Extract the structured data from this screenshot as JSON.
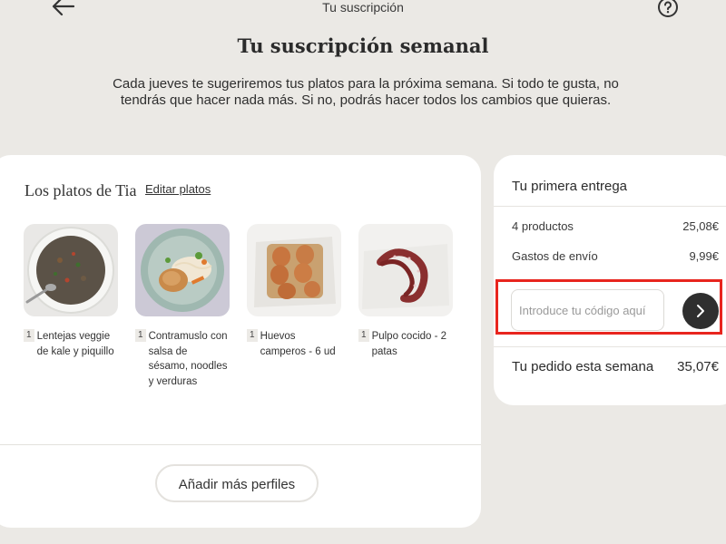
{
  "header": {
    "title": "Tu suscripción",
    "back_icon": "arrow-left-icon",
    "help_icon": "question-circle-icon"
  },
  "page": {
    "title": "Tu suscripción semanal",
    "intro": "Cada jueves te sugeriremos tus platos para la próxima semana. Si todo te gusta, no tendrás que hacer nada más. Si no, podrás hacer todos los cambios que quieras."
  },
  "plates": {
    "heading": "Los platos de Tia",
    "edit_label": "Editar platos",
    "items": [
      {
        "qty": "1",
        "name": "Lentejas veggie de kale y piquillo"
      },
      {
        "qty": "1",
        "name": "Contramuslo con salsa de sésamo, noodles y verduras"
      },
      {
        "qty": "1",
        "name": "Huevos camperos - 6 ud"
      },
      {
        "qty": "1",
        "name": "Pulpo cocido - 2 patas"
      }
    ],
    "add_profiles_label": "Añadir más perfiles"
  },
  "summary": {
    "title": "Tu primera entrega",
    "products_label": "4 productos",
    "products_value": "25,08€",
    "shipping_label": "Gastos de envío",
    "shipping_value": "9,99€",
    "promo_placeholder": "Introduce tu código aquí",
    "promo_value": "",
    "submit_icon": "chevron-right-icon",
    "total_label": "Tu pedido esta semana",
    "total_value": "35,07€"
  },
  "colors": {
    "background": "#ebe9e5",
    "card": "#ffffff",
    "dark_button": "#2f2f2f",
    "highlight": "#e8251e"
  }
}
